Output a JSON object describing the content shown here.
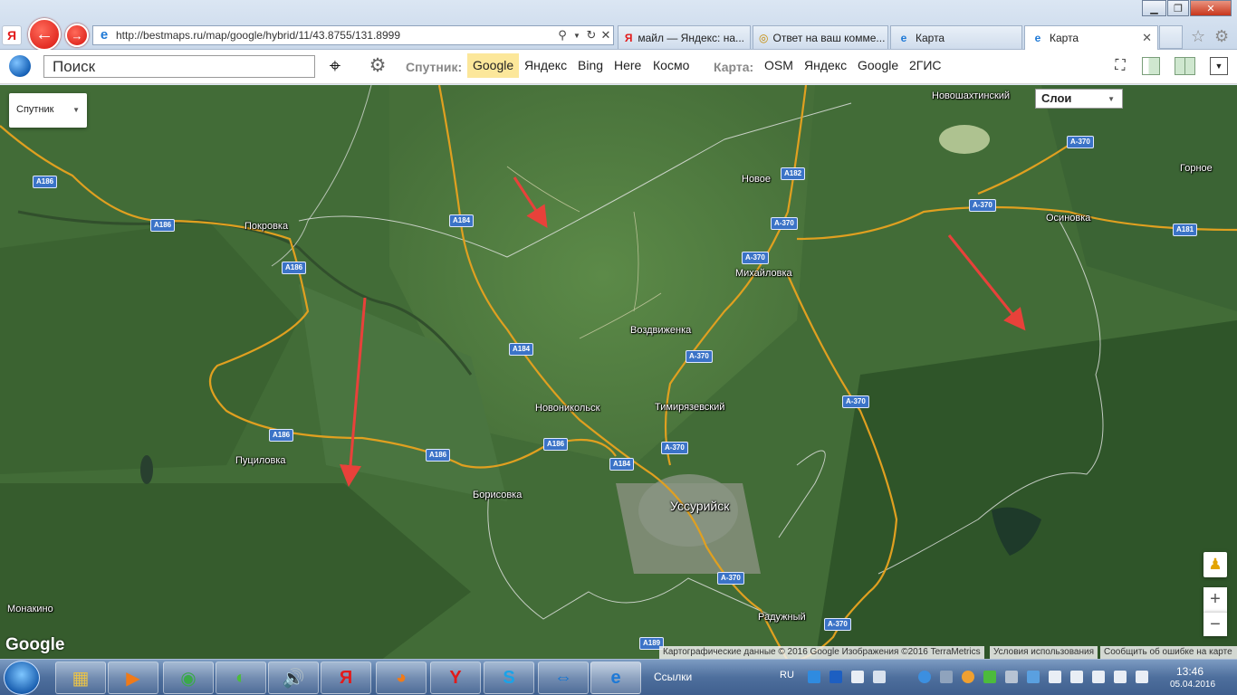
{
  "browser": {
    "address_url": "http://bestmaps.ru/map/google/hybrid/11/43.8755/131.8999",
    "tabs": [
      {
        "title": "майл — Яндекс: на..."
      },
      {
        "title": "Ответ на ваш комме..."
      },
      {
        "title": "Карта"
      },
      {
        "title": "Карта"
      }
    ]
  },
  "toolbar": {
    "search_value": "Поиск",
    "satellite_label": "Спутник:",
    "satellite_options": [
      "Google",
      "Яндекс",
      "Bing",
      "Here",
      "Космо"
    ],
    "map_label": "Карта:",
    "map_options": [
      "OSM",
      "Яндекс",
      "Google",
      "2ГИС"
    ]
  },
  "map": {
    "map_type": "Спутник",
    "layers": "Слои",
    "places": [
      "Новошахтинский",
      "Новое",
      "Горное",
      "Покровка",
      "Осиновка",
      "Михайловка",
      "Воздвиженка",
      "Новоникольск",
      "Тимирязевский",
      "Пуциловка",
      "Борисовка",
      "Уссурийск",
      "Монакино",
      "Радужный"
    ],
    "shields": [
      "A186",
      "A186",
      "A186",
      "A184",
      "A186",
      "A186",
      "A186",
      "A184",
      "A184",
      "A186",
      "A182",
      "A-370",
      "A-370",
      "A-370",
      "A-370",
      "A-370",
      "A-370",
      "A-370",
      "A-370",
      "A-370",
      "A181",
      "A189"
    ],
    "zoom_in": "+",
    "zoom_out": "−",
    "logo": "Google",
    "attribution": "Картографические данные © 2016 Google Изображения ©2016 TerraMetrics",
    "terms": "Условия использования",
    "report": "Сообщить об ошибке на карте"
  },
  "taskbar": {
    "links_label": "Ссылки",
    "language": "RU",
    "time": "13:46",
    "date": "05.04.2016"
  },
  "colors": {
    "map_base": "#3f6a35",
    "road": "#e0a020",
    "arrow": "#e8413a",
    "shield": "#3b73c7"
  }
}
